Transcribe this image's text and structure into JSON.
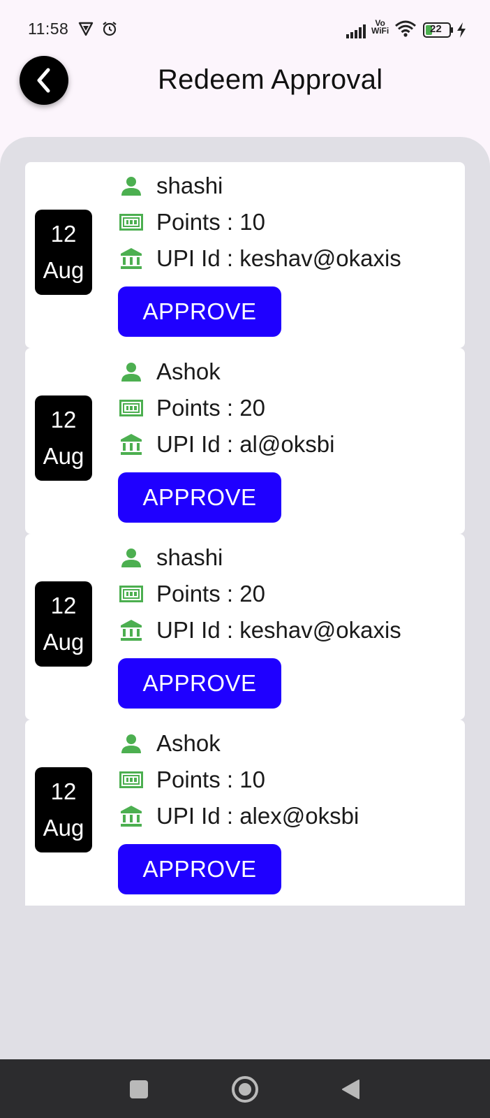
{
  "status_bar": {
    "time": "11:58",
    "battery_level": "22",
    "vowifi_top": "Vo",
    "vowifi_bottom": "WiFi",
    "icons": [
      "vpn-icon",
      "alarm-icon",
      "signal-icon",
      "vowifi-icon",
      "wifi-icon",
      "battery-icon",
      "charging-icon"
    ]
  },
  "header": {
    "title": "Redeem Approval",
    "back_icon": "chevron-left-icon"
  },
  "colors": {
    "accent_button": "#1f00ff",
    "icon_green": "#4caf50",
    "date_badge": "#000000",
    "panel_bg": "#e0dfe5"
  },
  "requests": [
    {
      "day": "12",
      "month": "Aug",
      "name": "shashi",
      "points": "Points : 10",
      "upi": "UPI Id : keshav@okaxis",
      "button": "APPROVE"
    },
    {
      "day": "12",
      "month": "Aug",
      "name": "Ashok",
      "points": "Points : 20",
      "upi": "UPI Id : al@oksbi",
      "button": "APPROVE"
    },
    {
      "day": "12",
      "month": "Aug",
      "name": "shashi",
      "points": "Points : 20",
      "upi": "UPI Id : keshav@okaxis",
      "button": "APPROVE"
    },
    {
      "day": "12",
      "month": "Aug",
      "name": "Ashok",
      "points": "Points : 10",
      "upi": "UPI Id : alex@oksbi",
      "button": "APPROVE"
    }
  ],
  "row_icons": {
    "name": "person-icon",
    "points": "money-note-icon",
    "upi": "bank-icon"
  },
  "nav_bar": {
    "buttons": [
      "recents-button",
      "home-button",
      "back-button"
    ]
  }
}
